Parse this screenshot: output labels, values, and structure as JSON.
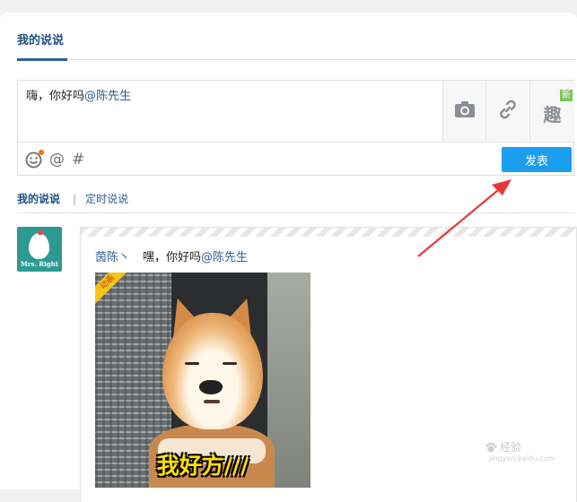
{
  "header": {
    "active_tab": "我的说说"
  },
  "composer": {
    "text": "嗨，你好吗",
    "mention": "@陈先生",
    "tools": [
      {
        "name": "camera-icon"
      },
      {
        "name": "link-icon"
      },
      {
        "name": "qu-icon",
        "glyph": "趣",
        "badge": "新"
      }
    ],
    "bottom_icons": [
      "emoji-icon",
      "at-icon",
      "hashtag-icon"
    ],
    "bottom_glyphs": {
      "at": "@",
      "hash": "#"
    },
    "publish_label": "发表",
    "publish_color": "#1a9ff0"
  },
  "subtabs": {
    "mine": "我的说说",
    "separator": "|",
    "timed": "定时说说"
  },
  "avatar": {
    "text": "Mrs. Right",
    "bg_color": "#2d9a93"
  },
  "post": {
    "author": "茵陈丶",
    "text": "嘿，你好吗",
    "mention": "@陈先生",
    "image": {
      "badge": "动画",
      "caption": "我好方///"
    }
  },
  "annotation": {
    "arrow_color": "#e8393a"
  },
  "watermark": {
    "text": "经验",
    "sub": "jingyan.baidu.com"
  }
}
